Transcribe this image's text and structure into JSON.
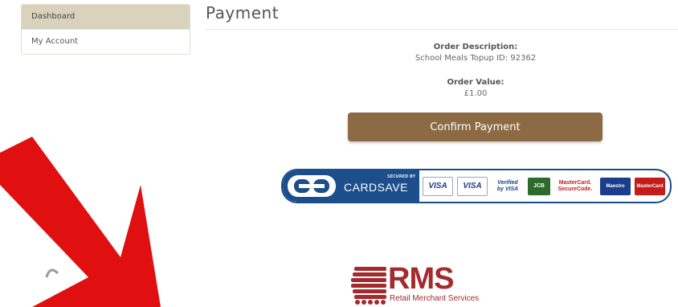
{
  "sidebar": {
    "items": [
      {
        "label": "Dashboard",
        "active": true
      },
      {
        "label": "My Account",
        "active": false
      }
    ]
  },
  "header": {
    "title": "Payment"
  },
  "order": {
    "description_label": "Order Description:",
    "description_value": "School Meals Topup ID: 92362",
    "value_label": "Order Value:",
    "value_amount": "£1.00"
  },
  "actions": {
    "confirm_label": "Confirm Payment"
  },
  "payment_banner": {
    "provider": "CARDSAVE",
    "secured_by": "SECURED BY",
    "cards": [
      {
        "name": "visa-icon",
        "label": "VISA"
      },
      {
        "name": "visa-electron-icon",
        "label": "VISA"
      },
      {
        "name": "verified-by-visa-icon",
        "label": "Verified by VISA"
      },
      {
        "name": "jcb-icon",
        "label": "JCB"
      },
      {
        "name": "mastercard-securecode-icon",
        "label": "MasterCard. SecureCode."
      },
      {
        "name": "maestro-icon",
        "label": "Maestro"
      },
      {
        "name": "mastercard-icon",
        "label": "MasterCard"
      }
    ]
  },
  "footer_logo": {
    "letters": "RMS",
    "subtitle": "Retail Merchant Services"
  },
  "colors": {
    "sidebar_active_bg": "#d9d2bd",
    "confirm_button_bg": "#8b6a44",
    "cardsave_blue": "#1b4e8a",
    "rms_red": "#a32a2d",
    "annotation_arrow": "#e01010"
  }
}
